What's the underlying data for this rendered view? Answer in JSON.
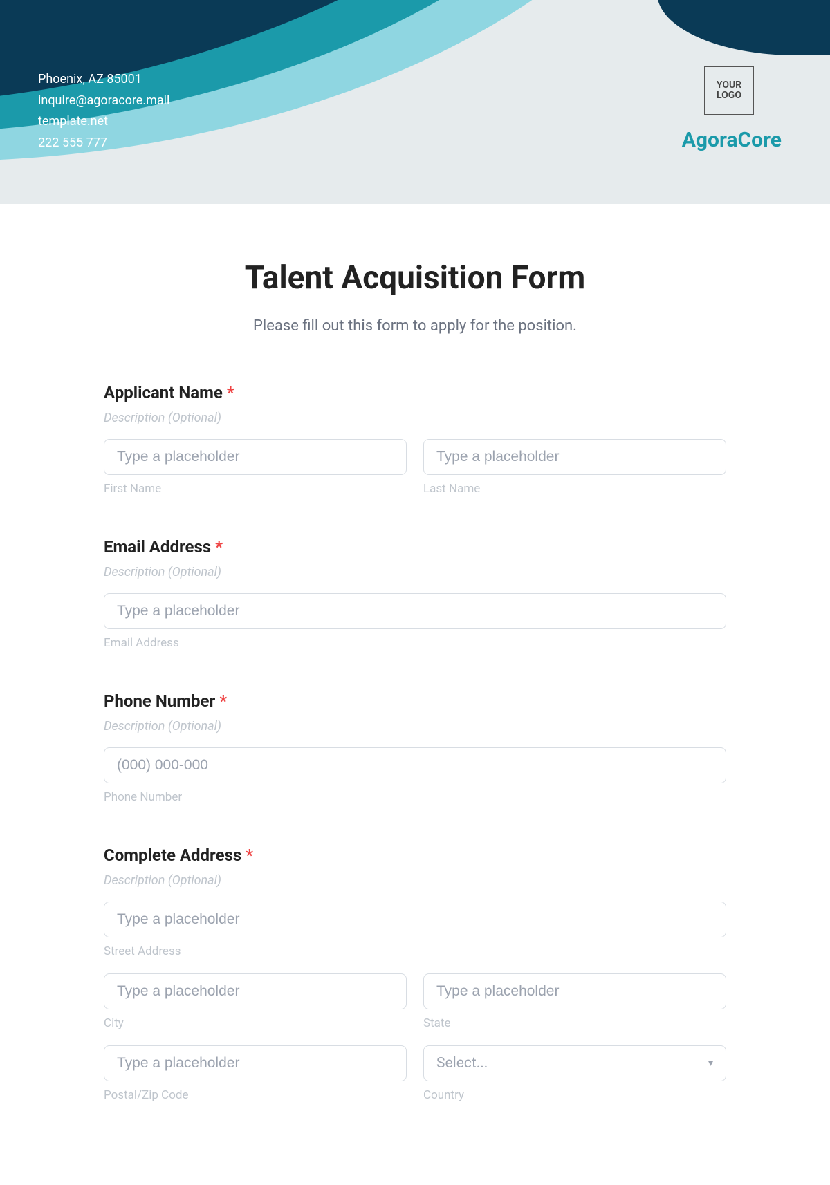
{
  "header": {
    "contact": {
      "line1": "Phoenix, AZ 85001",
      "line2": "inquire@agoracore.mail",
      "line3": "template.net",
      "line4": "222 555 777"
    },
    "logo_text": "YOUR LOGO",
    "brand": "AgoraCore"
  },
  "form": {
    "title": "Talent Acquisition Form",
    "subtitle": "Please fill out this form to apply for the position.",
    "desc_placeholder": "Description (Optional)",
    "input_placeholder": "Type a placeholder",
    "phone_placeholder": "(000) 000-000",
    "select_placeholder": "Select...",
    "fields": {
      "applicant_name": {
        "label": "Applicant Name",
        "first": "First Name",
        "last": "Last Name"
      },
      "email": {
        "label": "Email Address",
        "sub": "Email Address"
      },
      "phone": {
        "label": "Phone Number",
        "sub": "Phone Number"
      },
      "address": {
        "label": "Complete Address",
        "street": "Street Address",
        "city": "City",
        "state": "State",
        "postal": "Postal/Zip Code",
        "country": "Country"
      }
    }
  }
}
